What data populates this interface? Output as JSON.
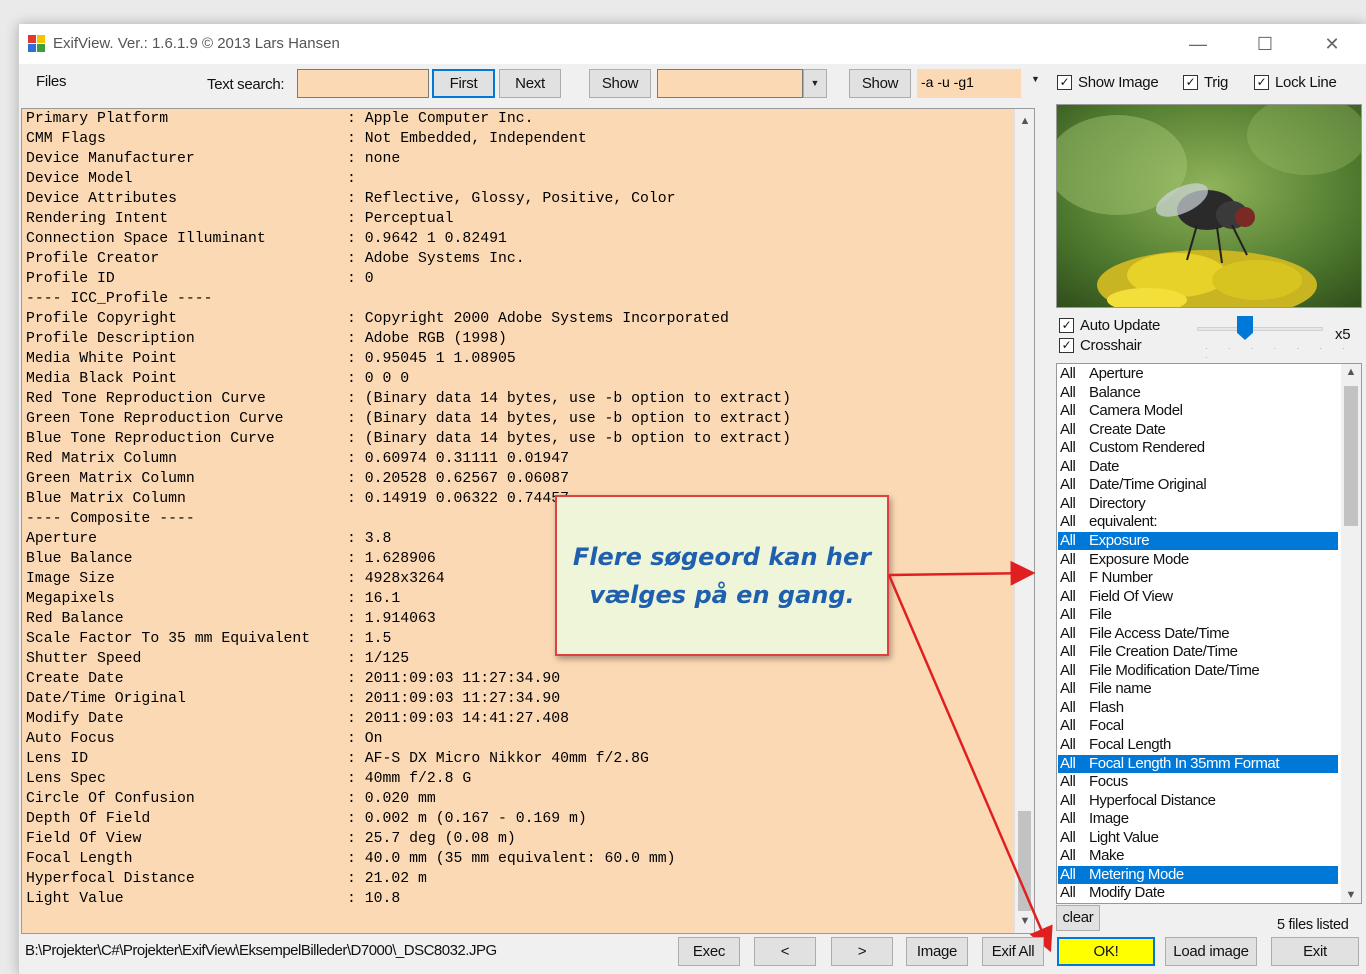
{
  "window": {
    "title": "ExifView. Ver.: 1.6.1.9 © 2013 Lars Hansen",
    "minimize": "—",
    "maximize": "☐",
    "close": "✕"
  },
  "toolbar": {
    "files_label": "Files",
    "text_search_label": "Text search:",
    "text_search_value": "",
    "first_label": "First",
    "next_label": "Next",
    "show1_label": "Show",
    "filter_value": "",
    "show2_label": "Show",
    "args_value": "-a -u -g1",
    "show_image_label": "Show Image",
    "show_image_checked": true,
    "trig_label": "Trig",
    "trig_checked": true,
    "lock_line_label": "Lock Line",
    "lock_line_checked": true
  },
  "exif_lines": [
    {
      "key": "Primary Platform",
      "val": ": Apple Computer Inc."
    },
    {
      "key": "CMM Flags",
      "val": ": Not Embedded, Independent"
    },
    {
      "key": "Device Manufacturer",
      "val": ": none"
    },
    {
      "key": "Device Model",
      "val": ":"
    },
    {
      "key": "Device Attributes",
      "val": ": Reflective, Glossy, Positive, Color"
    },
    {
      "key": "Rendering Intent",
      "val": ": Perceptual"
    },
    {
      "key": "Connection Space Illuminant",
      "val": ": 0.9642 1 0.82491"
    },
    {
      "key": "Profile Creator",
      "val": ": Adobe Systems Inc."
    },
    {
      "key": "Profile ID",
      "val": ": 0"
    },
    {
      "key": "---- ICC_Profile ----",
      "val": ""
    },
    {
      "key": "Profile Copyright",
      "val": ": Copyright 2000 Adobe Systems Incorporated"
    },
    {
      "key": "Profile Description",
      "val": ": Adobe RGB (1998)"
    },
    {
      "key": "Media White Point",
      "val": ": 0.95045 1 1.08905"
    },
    {
      "key": "Media Black Point",
      "val": ": 0 0 0"
    },
    {
      "key": "Red Tone Reproduction Curve",
      "val": ": (Binary data 14 bytes, use -b option to extract)"
    },
    {
      "key": "Green Tone Reproduction Curve",
      "val": ": (Binary data 14 bytes, use -b option to extract)"
    },
    {
      "key": "Blue Tone Reproduction Curve",
      "val": ": (Binary data 14 bytes, use -b option to extract)"
    },
    {
      "key": "Red Matrix Column",
      "val": ": 0.60974 0.31111 0.01947"
    },
    {
      "key": "Green Matrix Column",
      "val": ": 0.20528 0.62567 0.06087"
    },
    {
      "key": "Blue Matrix Column",
      "val": ": 0.14919 0.06322 0.74457"
    },
    {
      "key": "---- Composite ----",
      "val": ""
    },
    {
      "key": "Aperture",
      "val": ": 3.8"
    },
    {
      "key": "Blue Balance",
      "val": ": 1.628906"
    },
    {
      "key": "Image Size",
      "val": ": 4928x3264"
    },
    {
      "key": "Megapixels",
      "val": ": 16.1"
    },
    {
      "key": "Red Balance",
      "val": ": 1.914063"
    },
    {
      "key": "Scale Factor To 35 mm Equivalent",
      "val": ": 1.5"
    },
    {
      "key": "Shutter Speed",
      "val": ": 1/125"
    },
    {
      "key": "Create Date",
      "val": ": 2011:09:03 11:27:34.90"
    },
    {
      "key": "Date/Time Original",
      "val": ": 2011:09:03 11:27:34.90"
    },
    {
      "key": "Modify Date",
      "val": ": 2011:09:03 14:41:27.408"
    },
    {
      "key": "Auto Focus",
      "val": ": On"
    },
    {
      "key": "Lens ID",
      "val": ": AF-S DX Micro Nikkor 40mm f/2.8G"
    },
    {
      "key": "Lens Spec",
      "val": ": 40mm f/2.8 G"
    },
    {
      "key": "Circle Of Confusion",
      "val": ": 0.020 mm"
    },
    {
      "key": "Depth Of Field",
      "val": ": 0.002 m (0.167 - 0.169 m)"
    },
    {
      "key": "Field Of View",
      "val": ": 25.7 deg (0.08 m)"
    },
    {
      "key": "Focal Length",
      "val": ": 40.0 mm (35 mm equivalent: 60.0 mm)"
    },
    {
      "key": "Hyperfocal Distance",
      "val": ": 21.02 m"
    },
    {
      "key": "Light Value",
      "val": ": 10.8"
    }
  ],
  "side": {
    "auto_update_label": "Auto Update",
    "auto_update_checked": true,
    "crosshair_label": "Crosshair",
    "crosshair_checked": true,
    "zoom_label": "x5",
    "zoom_slider_fraction": 0.4
  },
  "tags": [
    {
      "group": "All",
      "name": "Aperture",
      "selected": false
    },
    {
      "group": "All",
      "name": "Balance",
      "selected": false
    },
    {
      "group": "All",
      "name": "Camera Model",
      "selected": false
    },
    {
      "group": "All",
      "name": "Create Date",
      "selected": false
    },
    {
      "group": "All",
      "name": "Custom Rendered",
      "selected": false
    },
    {
      "group": "All",
      "name": "Date",
      "selected": false
    },
    {
      "group": "All",
      "name": "Date/Time Original",
      "selected": false
    },
    {
      "group": "All",
      "name": "Directory",
      "selected": false
    },
    {
      "group": "All",
      "name": "equivalent:",
      "selected": false
    },
    {
      "group": "All",
      "name": "Exposure",
      "selected": true
    },
    {
      "group": "All",
      "name": "Exposure Mode",
      "selected": false
    },
    {
      "group": "All",
      "name": "F Number",
      "selected": false
    },
    {
      "group": "All",
      "name": "Field Of View",
      "selected": false
    },
    {
      "group": "All",
      "name": "File",
      "selected": false
    },
    {
      "group": "All",
      "name": "File Access Date/Time",
      "selected": false
    },
    {
      "group": "All",
      "name": "File Creation Date/Time",
      "selected": false
    },
    {
      "group": "All",
      "name": "File Modification Date/Time",
      "selected": false
    },
    {
      "group": "All",
      "name": "File name",
      "selected": false
    },
    {
      "group": "All",
      "name": "Flash",
      "selected": false
    },
    {
      "group": "All",
      "name": "Focal",
      "selected": false
    },
    {
      "group": "All",
      "name": "Focal Length",
      "selected": false
    },
    {
      "group": "All",
      "name": "Focal Length In 35mm Format",
      "selected": true
    },
    {
      "group": "All",
      "name": "Focus",
      "selected": false
    },
    {
      "group": "All",
      "name": "Hyperfocal Distance",
      "selected": false
    },
    {
      "group": "All",
      "name": "Image",
      "selected": false
    },
    {
      "group": "All",
      "name": "Light Value",
      "selected": false
    },
    {
      "group": "All",
      "name": "Make",
      "selected": false
    },
    {
      "group": "All",
      "name": "Metering Mode",
      "selected": true
    },
    {
      "group": "All",
      "name": "Modify Date",
      "selected": false
    }
  ],
  "callout": {
    "line1": "Flere søgeord kan her",
    "line2": "vælges på en gang."
  },
  "bottom": {
    "clear_label": "clear",
    "files_listed": "5 files listed",
    "path": "B:\\Projekter\\C#\\Projekter\\ExifView\\EksempelBilleder\\D7000\\_DSC8032.JPG",
    "exec_label": "Exec",
    "prev_label": "<",
    "next_label": ">",
    "image_label": "Image",
    "exif_all_label": "Exif All",
    "ok_label": "OK!",
    "load_image_label": "Load image",
    "exit_label": "Exit"
  },
  "colors": {
    "text_bg": "#fbd9b5",
    "selection": "#0078d7",
    "ok_button": "#ffff00",
    "callout_border": "#e04040",
    "callout_text": "#1f5fb0"
  }
}
